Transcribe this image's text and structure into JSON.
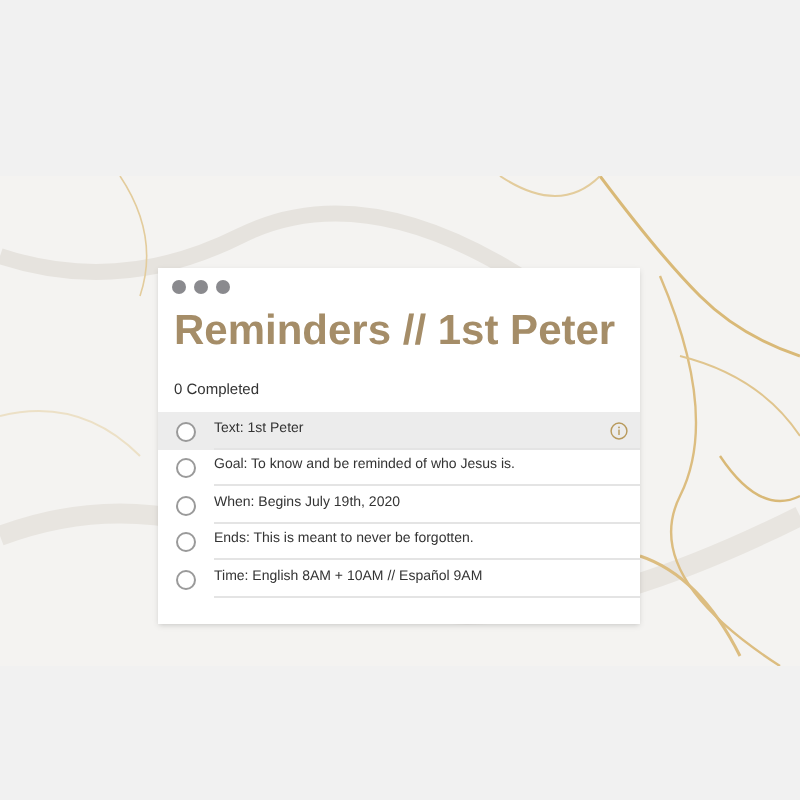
{
  "window": {
    "title": "Reminders // 1st Peter"
  },
  "completed": "0 Completed",
  "reminders": [
    {
      "text": "Text: 1st Peter",
      "selected": true
    },
    {
      "text": "Goal: To know and be reminded of who Jesus is.",
      "selected": false
    },
    {
      "text": "When: Begins July 19th, 2020",
      "selected": false
    },
    {
      "text": "Ends: This is meant to never be forgotten.",
      "selected": false
    },
    {
      "text": "Time: English 8AM + 10AM // Español 9AM",
      "selected": false
    }
  ]
}
